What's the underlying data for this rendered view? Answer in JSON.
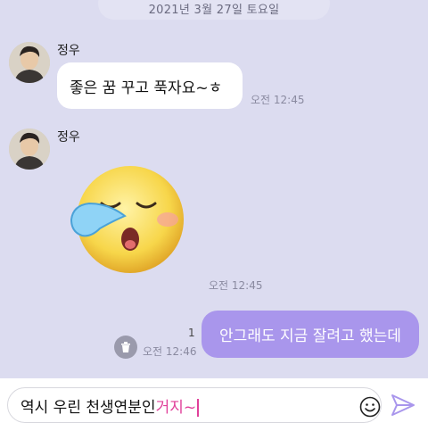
{
  "date_separator": "2021년 3월 27일 토요일",
  "messages": [
    {
      "sender": "정우",
      "text": "좋은 꿈 꾸고 푹자요~ㅎ",
      "time": "오전 12:45"
    },
    {
      "sender": "정우",
      "sticker": "sleeping-face-emoji",
      "time": "오전 12:45"
    },
    {
      "text": "안그래도 지금 잘려고 했는데",
      "time": "오전 12:46",
      "unread_count": "1"
    }
  ],
  "composer": {
    "text_committed": "역시 우린 천생연분인",
    "text_composing": "거지~"
  },
  "colors": {
    "background": "#dcdcf0",
    "outgoing_bubble": "#a996ec",
    "incoming_bubble": "#ffffff",
    "composing_text": "#e0409a",
    "send_icon": "#a996ec"
  },
  "icons": [
    "trash-icon",
    "emoji-icon",
    "send-icon",
    "avatar"
  ]
}
